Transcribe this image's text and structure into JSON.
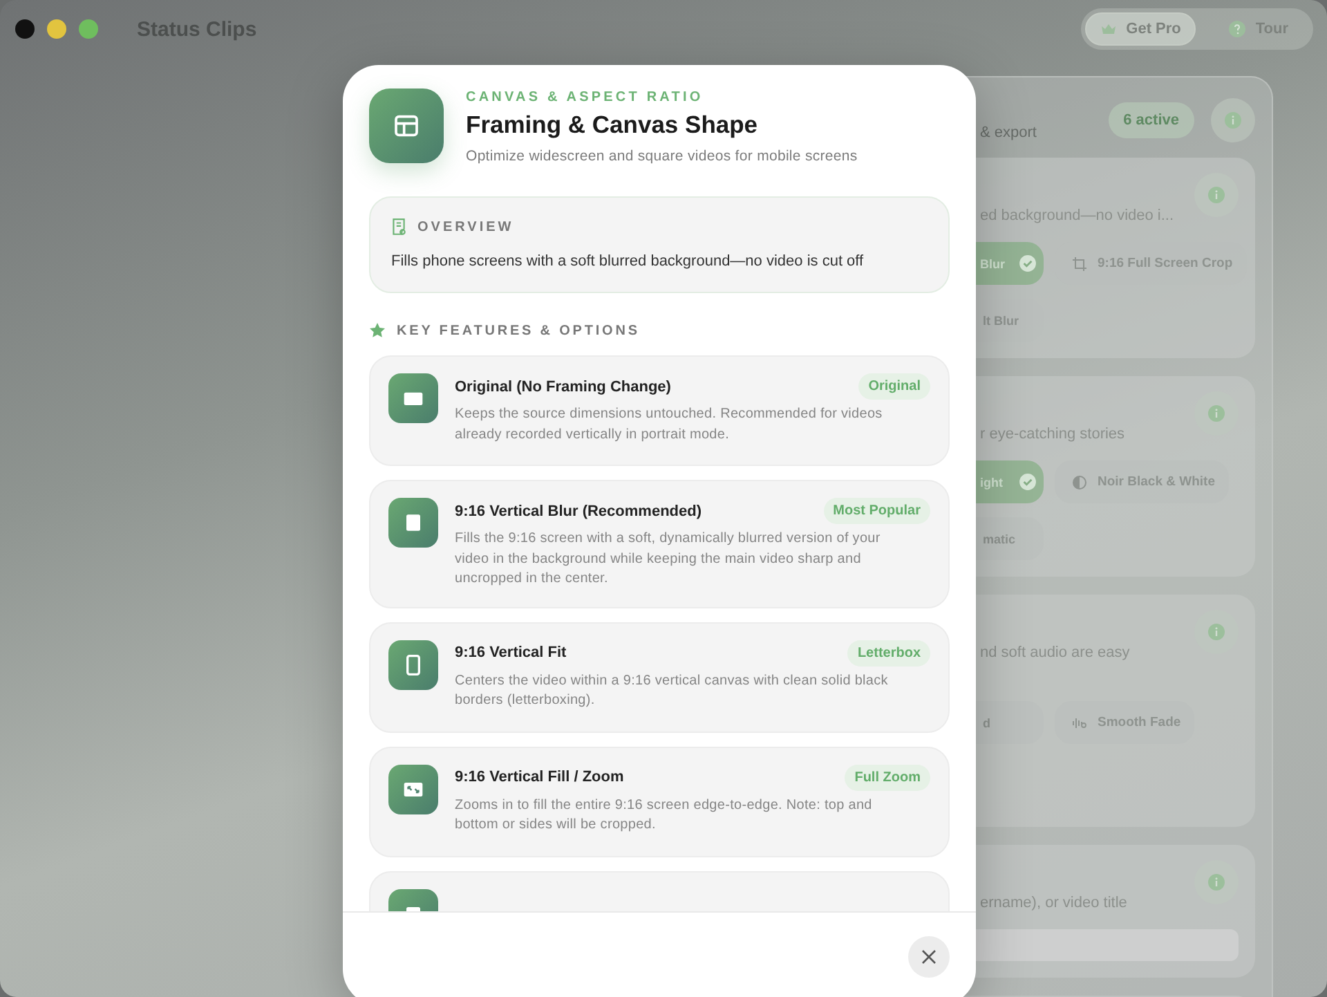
{
  "window": {
    "title": "Status Clips"
  },
  "toolbar": [
    {
      "kind": "pro",
      "label": "Get Pro"
    },
    {
      "kind": "tour",
      "label": "Tour"
    }
  ],
  "background_panel": {
    "badge": "6 active",
    "subtitle": "& export",
    "sections": [
      {
        "subtitle": "ed background—no video i...",
        "chips": [
          {
            "label": "Blur",
            "selected": true
          },
          {
            "label": "9:16 Full Screen Crop",
            "selected": false,
            "kind": "crop"
          },
          {
            "label": "lt Blur",
            "selected": false
          }
        ]
      },
      {
        "subtitle": "r eye-catching stories",
        "chips": [
          {
            "label": "ight",
            "selected": true
          },
          {
            "label": "Noir Black & White",
            "selected": false,
            "kind": "contrast"
          },
          {
            "label": "matic",
            "selected": false
          }
        ]
      },
      {
        "subtitle": "nd soft audio are easy",
        "chips": [
          {
            "label": "d",
            "selected": false
          },
          {
            "label": "Smooth Fade",
            "selected": false,
            "kind": "wave"
          }
        ]
      },
      {
        "subtitle": "ername), or video title",
        "field": true
      }
    ]
  },
  "dialog": {
    "eyebrow": "CANVAS & ASPECT RATIO",
    "title": "Framing & Canvas Shape",
    "subtitle": "Optimize widescreen and square videos for mobile screens",
    "overview": {
      "label": "OVERVIEW",
      "text": "Fills phone screens with a soft blurred background—no video is cut off"
    },
    "features_heading": "KEY FEATURES & OPTIONS",
    "features": [
      {
        "kind": "landscape",
        "title": "Original (No Framing Change)",
        "badge": "Original",
        "description": "Keeps the source dimensions untouched. Recommended for videos already recorded vertically in portrait mode."
      },
      {
        "kind": "square",
        "title": "9:16 Vertical Blur (Recommended)",
        "badge": "Most Popular",
        "description": "Fills the 9:16 screen with a soft, dynamically blurred version of your video in the background while keeping the main video sharp and uncropped in the center."
      },
      {
        "kind": "portrait",
        "title": "9:16 Vertical Fit",
        "badge": "Letterbox",
        "description": "Centers the video within a 9:16 vertical canvas with clean solid black borders (letterboxing)."
      },
      {
        "kind": "zoom",
        "title": "9:16 Vertical Fill / Zoom",
        "badge": "Full Zoom",
        "description": "Zooms in to fill the entire 9:16 screen edge-to-edge. Note: top and bottom or sides will be cropped."
      },
      {
        "kind": "generic"
      }
    ]
  }
}
